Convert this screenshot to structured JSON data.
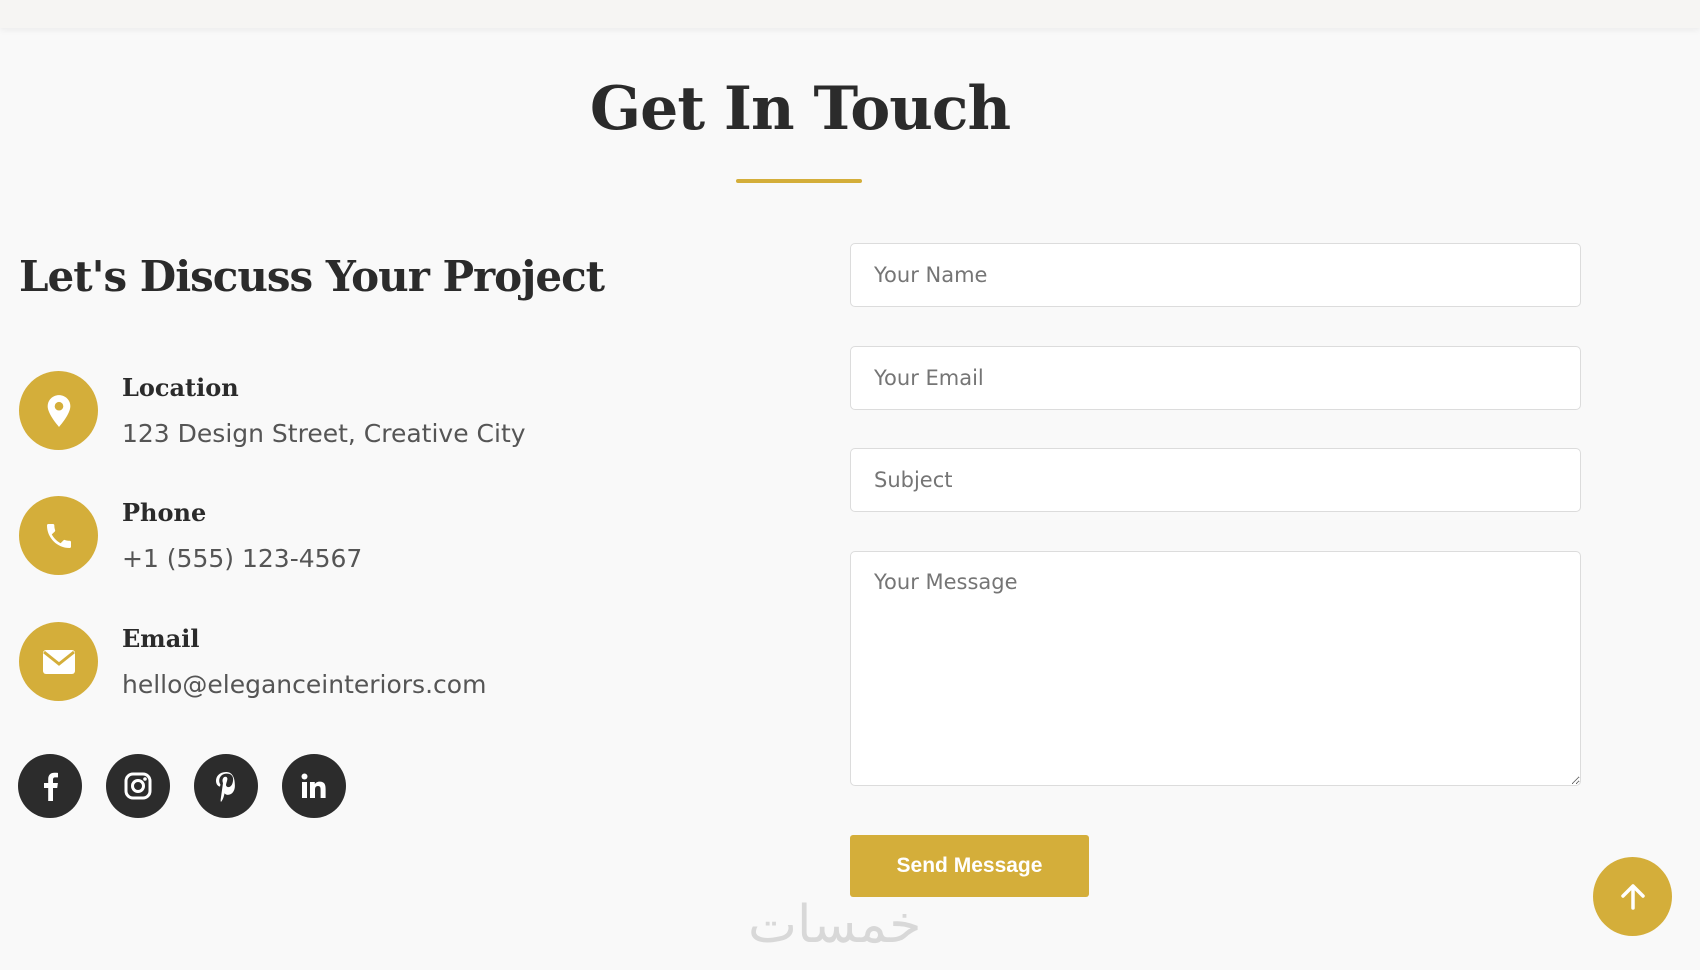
{
  "section": {
    "title": "Get In Touch",
    "accent_color": "#d4ae3a"
  },
  "contact_info": {
    "heading": "Let's Discuss Your Project",
    "items": [
      {
        "icon": "location-pin-icon",
        "label": "Location",
        "value": "123 Design Street, Creative City"
      },
      {
        "icon": "phone-icon",
        "label": "Phone",
        "value": "+1 (555) 123-4567"
      },
      {
        "icon": "envelope-icon",
        "label": "Email",
        "value": "hello@eleganceinteriors.com"
      }
    ],
    "socials": [
      {
        "icon": "facebook-icon"
      },
      {
        "icon": "instagram-icon"
      },
      {
        "icon": "pinterest-icon"
      },
      {
        "icon": "linkedin-icon"
      }
    ]
  },
  "form": {
    "name_placeholder": "Your Name",
    "email_placeholder": "Your Email",
    "subject_placeholder": "Subject",
    "message_placeholder": "Your Message",
    "submit_label": "Send Message"
  },
  "back_to_top": {
    "icon": "arrow-up-icon"
  },
  "watermark": {
    "text": "خمسات"
  }
}
